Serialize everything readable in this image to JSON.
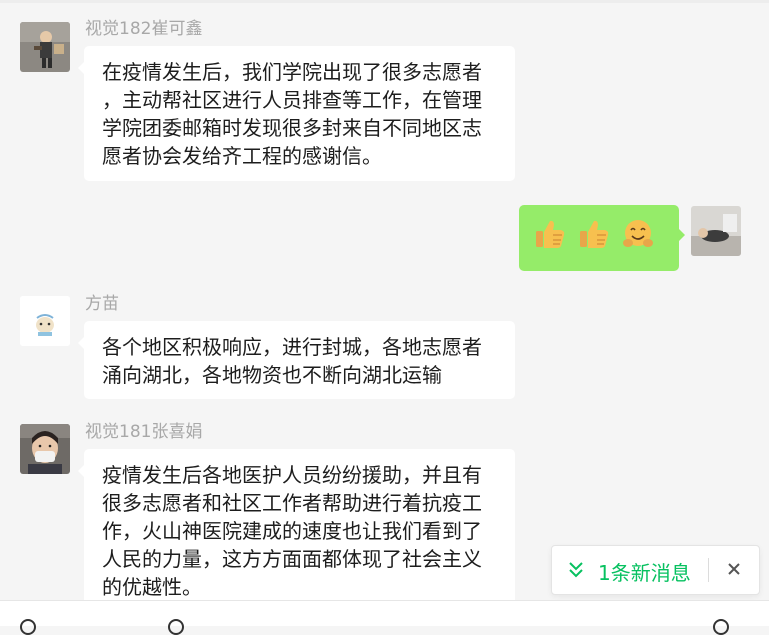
{
  "messages": [
    {
      "sender": "视觉182崔可鑫",
      "text": "在疫情发生后，我们学院出现了很多志愿者\n，主动帮社区进行人员排查等工作，在管理\n学院团委邮箱时发现很多封来自不同地区志\n愿者协会发给齐工程的感谢信。"
    },
    {
      "sender": "",
      "emojis": [
        "thumbs-up-emoji",
        "thumbs-up-emoji",
        "hug-emoji"
      ]
    },
    {
      "sender": "方苗",
      "text": "各个地区积极响应，进行封城，各地志愿者\n涌向湖北，各地物资也不断向湖北运输"
    },
    {
      "sender": "视觉181张喜娟",
      "text": "疫情发生后各地医护人员纷纷援助，并且有\n很多志愿者和社区工作者帮助进行着抗疫工\n作，火山神医院建成的速度也让我们看到了\n人民的力量，这方方面面都体现了社会主义\n的优越性。"
    }
  ],
  "new_message_bar": {
    "label": "1条新消息",
    "icons": [
      "double-chevron-down-icon",
      "close-icon"
    ]
  },
  "colors": {
    "background": "#f5f5f5",
    "bubble_other": "#ffffff",
    "bubble_mine": "#95ec69",
    "accent": "#07c160",
    "name_text": "#a8a8a8"
  }
}
